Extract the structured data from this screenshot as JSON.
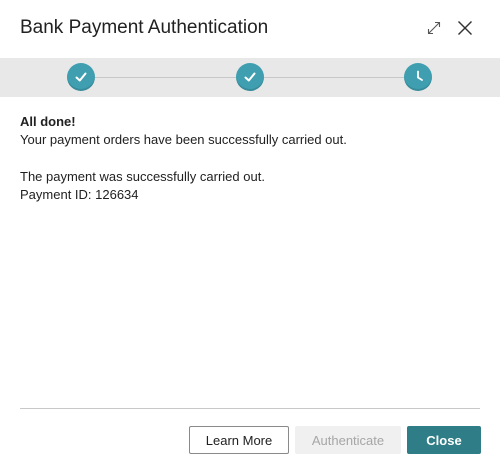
{
  "dialog": {
    "title": "Bank Payment Authentication"
  },
  "header_icons": {
    "expand": "expand-icon",
    "close": "close-icon"
  },
  "stepper": {
    "steps": [
      {
        "status": "completed",
        "icon": "checkmark-icon"
      },
      {
        "status": "completed",
        "icon": "checkmark-icon"
      },
      {
        "status": "pending",
        "icon": "clock-icon"
      }
    ],
    "step_color": "#3f9fb0"
  },
  "content": {
    "heading": "All done!",
    "message": "Your payment orders have been successfully carried out.",
    "payment_status": "The payment was successfully carried out.",
    "payment_id": "Payment ID: 126634"
  },
  "buttons": {
    "learn_more": "Learn More",
    "authenticate": "Authenticate",
    "authenticate_enabled": false,
    "close": "Close"
  },
  "colors": {
    "primary": "#2f7d86",
    "stepper_bg": "#e8e8e8"
  }
}
